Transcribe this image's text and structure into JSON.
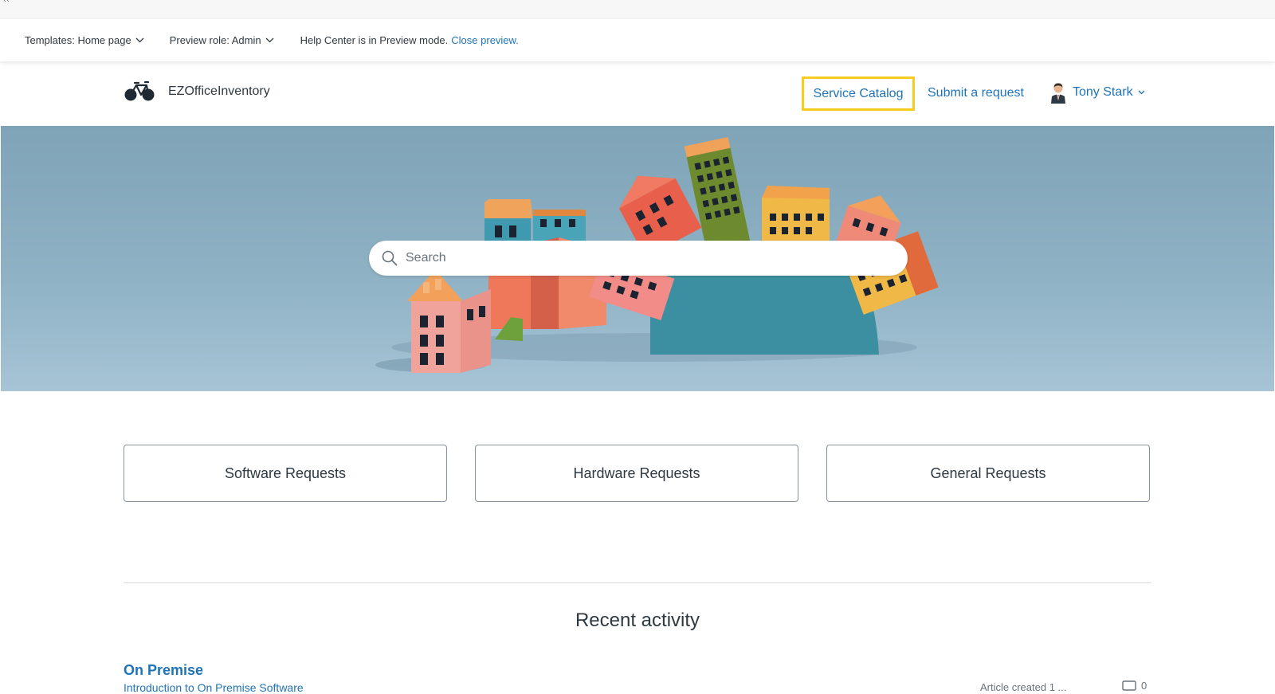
{
  "top_strip": {
    "mark": "``"
  },
  "preview_bar": {
    "templates_label": "Templates: Home page",
    "role_label": "Preview role: Admin",
    "help_text": "Help Center is in Preview mode.",
    "close_link": "Close preview."
  },
  "header": {
    "brand_name": "EZOfficeInventory",
    "logo_icon": "bicycle-icon",
    "nav": {
      "service_catalog": "Service Catalog",
      "submit_request": "Submit a request",
      "user_name": "Tony Stark"
    },
    "highlight_color": "#f7cc21",
    "link_color": "#1f73b7"
  },
  "hero": {
    "search_placeholder": "Search",
    "search_icon": "search-icon"
  },
  "categories": [
    {
      "label": "Software Requests"
    },
    {
      "label": "Hardware Requests"
    },
    {
      "label": "General Requests"
    }
  ],
  "recent_activity": {
    "heading": "Recent activity",
    "items": [
      {
        "section": "On Premise",
        "article": "Introduction to On Premise Software",
        "meta": "Article created 1 ...",
        "comment_count": "0"
      }
    ]
  }
}
